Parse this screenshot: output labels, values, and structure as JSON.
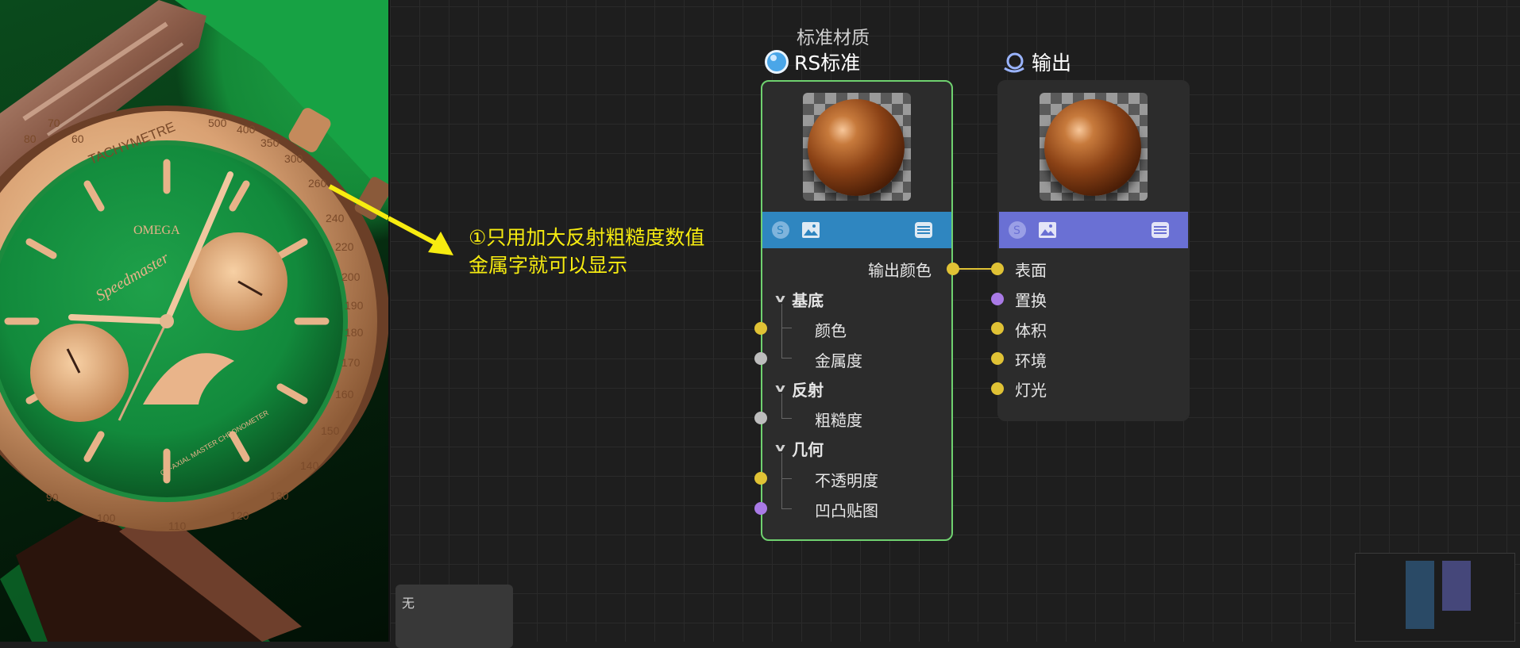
{
  "annotation": {
    "line1": "①只用加大反射粗糙度数值",
    "line2": "金属字就可以显示",
    "color": "#f7ec10"
  },
  "material_node": {
    "subtitle": "标准材质",
    "title": "RS标准",
    "icon": "sphere-material-icon",
    "output_label": "输出颜色",
    "groups": [
      {
        "label": "基底",
        "items": [
          {
            "label": "颜色",
            "port": "yellow"
          },
          {
            "label": "金属度",
            "port": "grey"
          }
        ]
      },
      {
        "label": "反射",
        "items": [
          {
            "label": "粗糙度",
            "port": "grey"
          }
        ]
      },
      {
        "label": "几何",
        "items": [
          {
            "label": "不透明度",
            "port": "yellow"
          },
          {
            "label": "凹凸贴图",
            "port": "purple"
          }
        ]
      }
    ],
    "border_color": "#6fd16f",
    "bar_color": "#2f86c0"
  },
  "output_node": {
    "title": "输出",
    "icon": "output-node-icon",
    "inputs": [
      {
        "label": "表面",
        "port": "yellow"
      },
      {
        "label": "置换",
        "port": "purple"
      },
      {
        "label": "体积",
        "port": "yellow"
      },
      {
        "label": "环境",
        "port": "yellow"
      },
      {
        "label": "灯光",
        "port": "yellow"
      }
    ],
    "bar_color": "#6a70d4"
  },
  "info_box": {
    "text": "无"
  },
  "watch": {
    "tachymeter": "TACHYMETRE",
    "brand": "OMEGA",
    "model": "Speedmaster",
    "dial_text": "CO-AXIAL MASTER CHRONOMETER",
    "scale": [
      "500",
      "400",
      "350",
      "300",
      "260",
      "240",
      "220",
      "200",
      "190",
      "180",
      "170",
      "160",
      "150",
      "140",
      "130",
      "120",
      "110",
      "100",
      "90",
      "80",
      "70",
      "60"
    ]
  }
}
